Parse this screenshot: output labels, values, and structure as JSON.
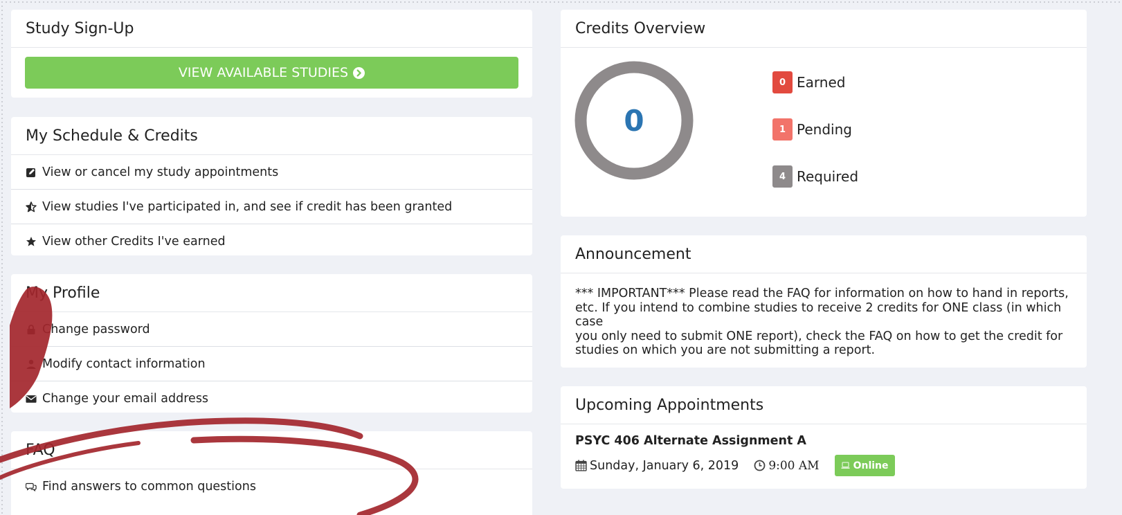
{
  "signup": {
    "title": "Study Sign-Up",
    "button_label": "VIEW AVAILABLE STUDIES"
  },
  "schedule": {
    "title": "My Schedule & Credits",
    "items": [
      {
        "label": "View or cancel my study appointments",
        "icon": "edit-icon"
      },
      {
        "label": "View studies I've participated in, and see if credit has been granted",
        "icon": "star-half-icon"
      },
      {
        "label": "View other Credits I've earned",
        "icon": "star-icon"
      }
    ]
  },
  "profile": {
    "title": "My Profile",
    "items": [
      {
        "label": "Change password",
        "icon": "lock-icon"
      },
      {
        "label": "Modify contact information",
        "icon": "user-icon"
      },
      {
        "label": "Change your email address",
        "icon": "envelope-icon"
      }
    ]
  },
  "faq": {
    "title": "FAQ",
    "items": [
      {
        "label": "Find answers to common questions",
        "icon": "comments-icon"
      }
    ]
  },
  "credits": {
    "title": "Credits Overview",
    "center_value": "0",
    "legend": [
      {
        "count": "0",
        "label": "Earned",
        "color": "#e24a3f"
      },
      {
        "count": "1",
        "label": "Pending",
        "color": "#f2736a"
      },
      {
        "count": "4",
        "label": "Required",
        "color": "#8e8a8b"
      }
    ],
    "ring_color": "#8e8a8b"
  },
  "announcement": {
    "title": "Announcement",
    "lines": [
      "*** IMPORTANT*** Please read the FAQ for information on how to hand in reports,",
      "etc. If you intend to combine studies to receive 2 credits for ONE class (in which case",
      "you only need to submit ONE report), check the FAQ on how to get the credit for",
      "studies on which you are not submitting a report."
    ]
  },
  "upcoming": {
    "title": "Upcoming Appointments",
    "appointment": {
      "name": "PSYC 406 Alternate Assignment A",
      "date": "Sunday, January 6, 2019",
      "time": "9:00 AM",
      "badge": "Online"
    }
  },
  "colors": {
    "accent_green": "#7ccb59",
    "donut_value": "#2b75b2",
    "page_bg": "#eff1f6",
    "annotation_red": "#a3262d"
  }
}
